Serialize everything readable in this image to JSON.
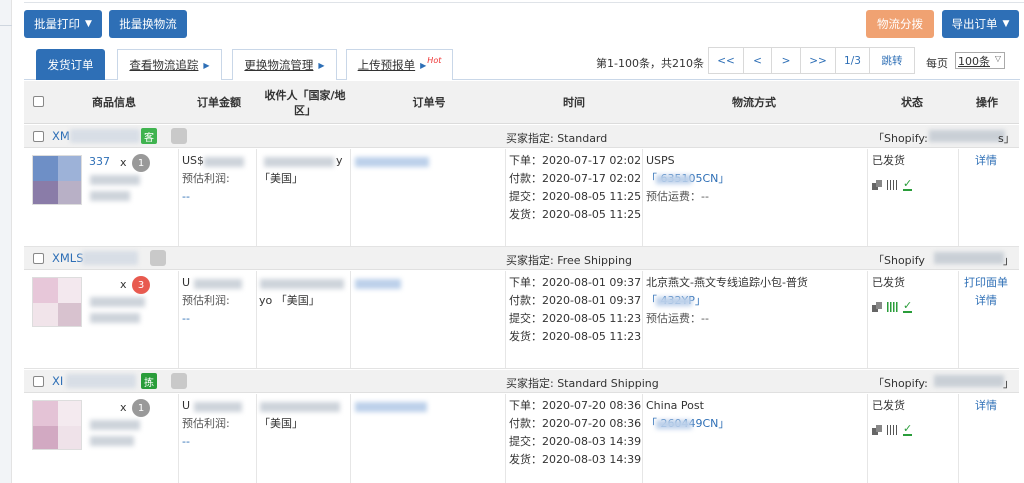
{
  "toolbar": {
    "batch_print": "批量打印",
    "batch_change_logistics": "批量换物流",
    "logistics_allocate": "物流分拨",
    "export_orders": "导出订单"
  },
  "tabs": {
    "ship_orders": "发货订单",
    "view_tracking": "查看物流追踪",
    "change_logistics_mgmt": "更换物流管理",
    "upload_pre_report": "上传预报单",
    "hot": "Hot"
  },
  "pager": {
    "info": "第1-100条，共210条",
    "first": "<<",
    "prev": "<",
    "next": ">",
    "last": ">>",
    "page": "1/3",
    "jump": "跳转",
    "per_page_label": "每页",
    "per_page_value": "100条"
  },
  "table": {
    "headers": {
      "product": "商品信息",
      "amount": "订单金额",
      "recipient": "收件人「国家/地区」",
      "order_no": "订单号",
      "time": "时间",
      "shipping": "物流方式",
      "status": "状态",
      "action": "操作"
    },
    "orders": [
      {
        "prefix": "XM",
        "tag": "客",
        "tag_color": "#3fb34f",
        "buyer_specified": "买家指定:  Standard",
        "shop": "「Shopify:",
        "shop_end": "s」",
        "sku_suffix": "337",
        "qty": "1",
        "amount_prefix": "US$",
        "profit_label": "预估利润:",
        "profit_value": "--",
        "recipient_suffix": "y",
        "country": "「美国」",
        "times": [
          "下单：2020-07-17 02:02",
          "付款：2020-07-17 02:02",
          "提交：2020-08-05 11:25",
          "发货：2020-08-05 11:25"
        ],
        "carrier": "USPS",
        "tracking": "「        635105CN」",
        "freight": "预估运费：--",
        "status": "已发货",
        "actions": [
          "详情"
        ]
      },
      {
        "prefix": "XMLS",
        "tag": "",
        "tag_color": "",
        "buyer_specified": "买家指定:  Free Shipping",
        "shop": "「Shopify",
        "shop_end": "」",
        "sku_suffix": "",
        "qty": "3",
        "amount_prefix": "U",
        "profit_label": "预估利润:",
        "profit_value": "--",
        "recipient_suffix": "yo  「美国」",
        "country": "",
        "times": [
          "下单：2020-08-01 09:37",
          "付款：2020-08-01 09:37",
          "提交：2020-08-05 11:23",
          "发货：2020-08-05 11:23"
        ],
        "carrier": "北京燕文-燕文专线追踪小包-普货",
        "tracking": "「        432YP」",
        "freight": "预估运费：--",
        "status": "已发货",
        "actions": [
          "打印面单",
          "详情"
        ]
      },
      {
        "prefix": "XI",
        "tag": "拣",
        "tag_color": "#2a9d3a",
        "buyer_specified": "买家指定:  Standard Shipping",
        "shop": "「Shopify:",
        "shop_end": "」",
        "sku_suffix": "",
        "qty": "1",
        "amount_prefix": "U",
        "profit_label": "预估利润:",
        "profit_value": "--",
        "recipient_suffix": "",
        "country": "「美国」",
        "times": [
          "下单：2020-07-20 08:36",
          "付款：2020-07-20 08:36",
          "提交：2020-08-03 14:39",
          "发货：2020-08-03 14:39"
        ],
        "carrier": "China Post",
        "tracking": "「        260449CN」",
        "freight": "",
        "status": "已发货",
        "actions": [
          "详情"
        ]
      }
    ]
  }
}
